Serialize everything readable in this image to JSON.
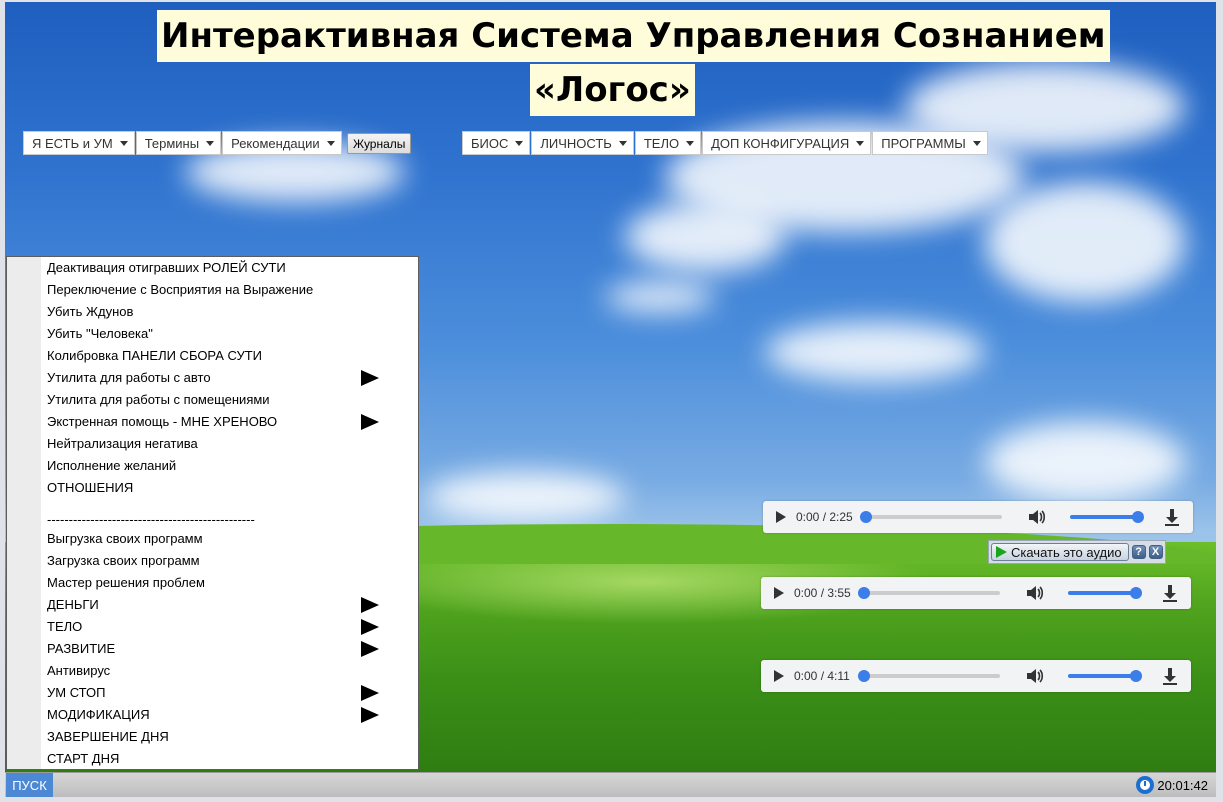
{
  "title": {
    "line1": "Интерактивная Система Управления Сознанием",
    "line2": "«Логос»"
  },
  "top_menu": {
    "left": [
      {
        "label": "Я ЕСТЬ и УМ"
      },
      {
        "label": "Термины"
      },
      {
        "label": "Рекомендации"
      }
    ],
    "journals_button": "Журналы",
    "right": [
      {
        "label": "БИОС"
      },
      {
        "label": "ЛИЧНОСТЬ"
      },
      {
        "label": "ТЕЛО"
      },
      {
        "label": "ДОП КОНФИГУРАЦИЯ"
      },
      {
        "label": "ПРОГРАММЫ"
      }
    ]
  },
  "start_menu": {
    "items": [
      {
        "label": "Деактивация отигравших РОЛЕЙ СУТИ",
        "submenu": false
      },
      {
        "label": "Переключение с Восприятия на Выражение",
        "submenu": false
      },
      {
        "label": "Убить Ждунов",
        "submenu": false
      },
      {
        "label": "Убить \"Человека\"",
        "submenu": false
      },
      {
        "label": "Колибровка ПАНЕЛИ СБОРА СУТИ",
        "submenu": false
      },
      {
        "label": "Утилита для работы с авто",
        "submenu": true
      },
      {
        "label": "Утилита для работы с помещениями",
        "submenu": false
      },
      {
        "label": "Экстренная помощь - МНЕ ХРЕНОВО",
        "submenu": true
      },
      {
        "label": "Нейтрализация негатива",
        "submenu": false
      },
      {
        "label": "Исполнение желаний",
        "submenu": false
      },
      {
        "label": "ОТНОШЕНИЯ",
        "submenu": false
      },
      {
        "label": "------------------------------------------------",
        "submenu": false,
        "separator": true
      },
      {
        "label": "Выгрузка своих программ",
        "submenu": false
      },
      {
        "label": "Загрузка своих программ",
        "submenu": false
      },
      {
        "label": "Мастер решения проблем",
        "submenu": false
      },
      {
        "label": "ДЕНЬГИ",
        "submenu": true
      },
      {
        "label": "ТЕЛО",
        "submenu": true
      },
      {
        "label": "РАЗВИТИЕ",
        "submenu": true
      },
      {
        "label": "Антивирус",
        "submenu": false
      },
      {
        "label": "УМ СТОП",
        "submenu": true
      },
      {
        "label": "МОДИФИКАЦИЯ",
        "submenu": true
      },
      {
        "label": "ЗАВЕРШЕНИЕ ДНЯ",
        "submenu": false
      },
      {
        "label": "СТАРТ ДНЯ",
        "submenu": false
      }
    ]
  },
  "audio_players": [
    {
      "time": "0:00 / 2:25",
      "progress": 0.0,
      "volume": 1.0
    },
    {
      "time": "0:00 / 3:55",
      "progress": 0.0,
      "volume": 1.0
    },
    {
      "time": "0:00 / 4:11",
      "progress": 0.0,
      "volume": 1.0
    }
  ],
  "download_bar": {
    "label": "Скачать это аудио",
    "help": "?",
    "close": "X"
  },
  "taskbar": {
    "start_label": "ПУСК",
    "clock": "20:01:42"
  },
  "colors": {
    "accent": "#3b7de9",
    "start_button": "#4d88d4",
    "title_bg": "#fffdd9"
  }
}
